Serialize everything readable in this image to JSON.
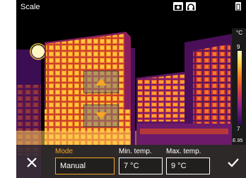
{
  "screen": {
    "title": "Scale",
    "top_icons": [
      "camera-icon",
      "headset-icon",
      "battery-icon"
    ]
  },
  "scale": {
    "unit": "°C",
    "max": "9",
    "min": "7",
    "emissivity": "E.95"
  },
  "controls": {
    "mode_label": "Mode",
    "mode_value": "Manual",
    "min_label": "Min. temp.",
    "min_value": "7 °C",
    "max_label": "Max. temp.",
    "max_value": "9 °C"
  },
  "colors": {
    "accent_orange": "#f5a623",
    "palette": [
      "#000000",
      "#3a0a6e",
      "#8a1e8c",
      "#d63b4b",
      "#f57b1f",
      "#ffd84d",
      "#fff7c2"
    ]
  }
}
